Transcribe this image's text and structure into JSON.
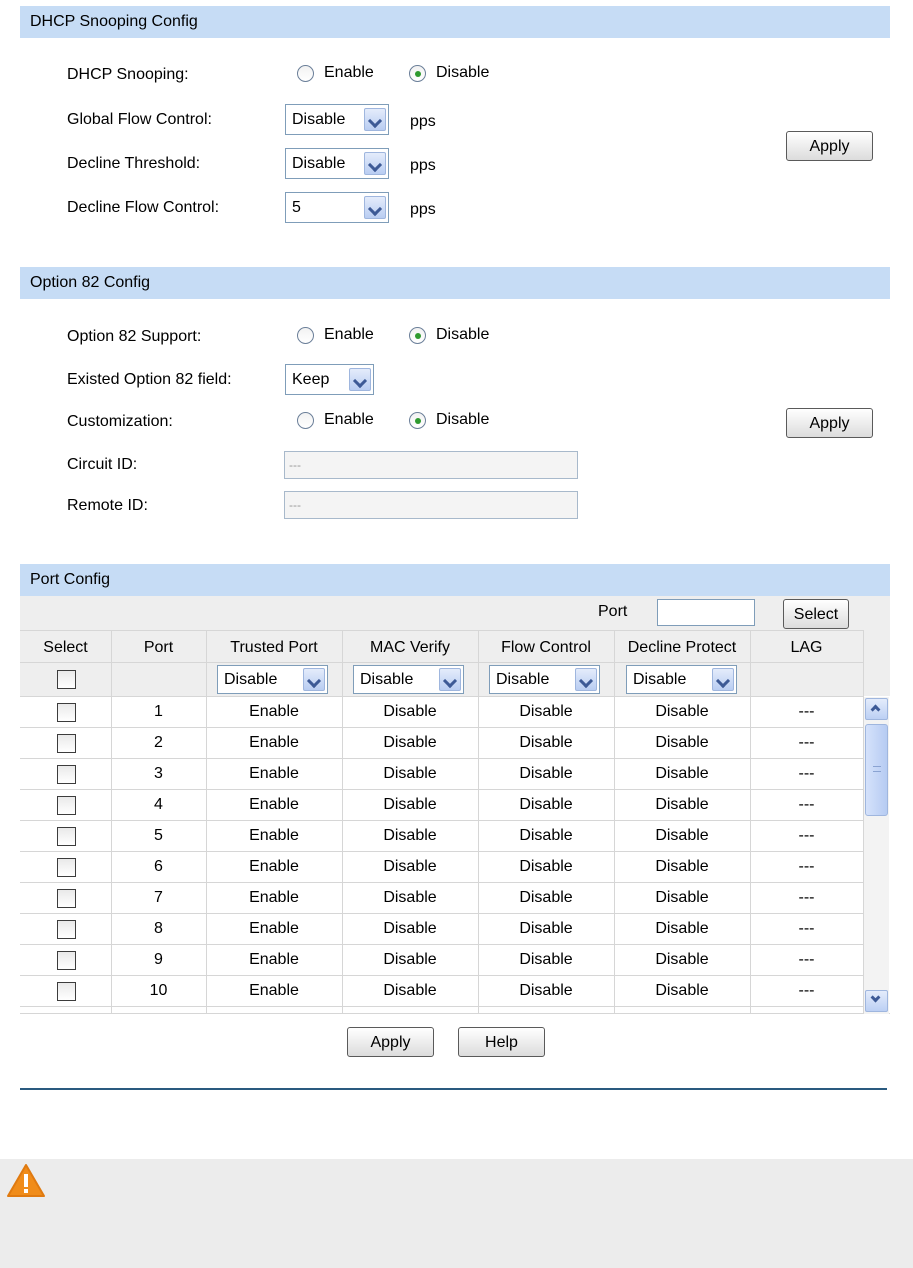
{
  "dhcp_snooping_config": {
    "title": "DHCP Snooping Config",
    "dhcp_snooping_label": "DHCP Snooping:",
    "enable_label": "Enable",
    "disable_label": "Disable",
    "global_flow_label": "Global Flow Control:",
    "global_flow_value": "Disable",
    "decline_threshold_label": "Decline Threshold:",
    "decline_threshold_value": "Disable",
    "decline_flow_label": "Decline Flow Control:",
    "decline_flow_value": "5",
    "unit": "pps",
    "apply_label": "Apply"
  },
  "option82_config": {
    "title": "Option 82 Config",
    "support_label": "Option 82 Support:",
    "enable_label": "Enable",
    "disable_label": "Disable",
    "existed_field_label": "Existed Option 82 field:",
    "existed_field_value": "Keep",
    "customization_label": "Customization:",
    "circuit_id_label": "Circuit ID:",
    "circuit_id_value": "---",
    "remote_id_label": "Remote ID:",
    "remote_id_value": "---",
    "apply_label": "Apply"
  },
  "port_config": {
    "title": "Port Config",
    "port_label": "Port",
    "port_input_value": "",
    "select_button_label": "Select",
    "columns": [
      "Select",
      "Port",
      "Trusted Port",
      "MAC Verify",
      "Flow Control",
      "Decline Protect",
      "LAG"
    ],
    "filter_values": [
      "Disable",
      "Disable",
      "Disable",
      "Disable"
    ],
    "rows": [
      {
        "port": "1",
        "trusted": "Enable",
        "mac": "Disable",
        "flow": "Disable",
        "decline": "Disable",
        "lag": "---"
      },
      {
        "port": "2",
        "trusted": "Enable",
        "mac": "Disable",
        "flow": "Disable",
        "decline": "Disable",
        "lag": "---"
      },
      {
        "port": "3",
        "trusted": "Enable",
        "mac": "Disable",
        "flow": "Disable",
        "decline": "Disable",
        "lag": "---"
      },
      {
        "port": "4",
        "trusted": "Enable",
        "mac": "Disable",
        "flow": "Disable",
        "decline": "Disable",
        "lag": "---"
      },
      {
        "port": "5",
        "trusted": "Enable",
        "mac": "Disable",
        "flow": "Disable",
        "decline": "Disable",
        "lag": "---"
      },
      {
        "port": "6",
        "trusted": "Enable",
        "mac": "Disable",
        "flow": "Disable",
        "decline": "Disable",
        "lag": "---"
      },
      {
        "port": "7",
        "trusted": "Enable",
        "mac": "Disable",
        "flow": "Disable",
        "decline": "Disable",
        "lag": "---"
      },
      {
        "port": "8",
        "trusted": "Enable",
        "mac": "Disable",
        "flow": "Disable",
        "decline": "Disable",
        "lag": "---"
      },
      {
        "port": "9",
        "trusted": "Enable",
        "mac": "Disable",
        "flow": "Disable",
        "decline": "Disable",
        "lag": "---"
      },
      {
        "port": "10",
        "trusted": "Enable",
        "mac": "Disable",
        "flow": "Disable",
        "decline": "Disable",
        "lag": "---"
      }
    ],
    "apply_label": "Apply",
    "help_label": "Help"
  },
  "colors": {
    "section_bar": "#c6dcf5",
    "divider": "#2a5a7f",
    "warning_bg": "#ececec",
    "warning_icon": "#f08c1a"
  }
}
